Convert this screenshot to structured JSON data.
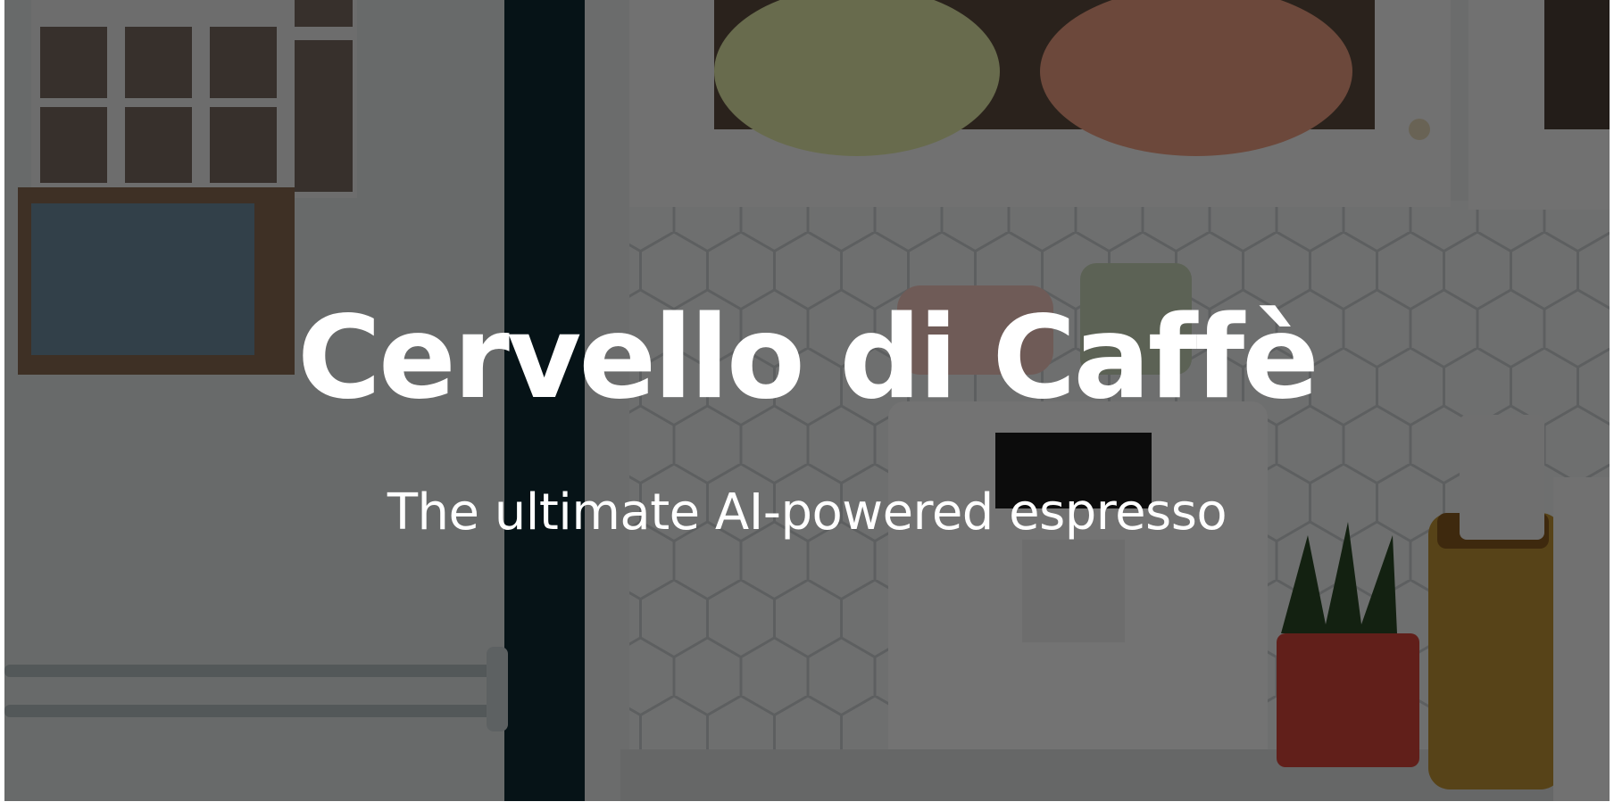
{
  "hero": {
    "title": "Cervello di Caffè",
    "subtitle": "The ultimate AI-powered espresso",
    "background": {
      "image": "kitchen-counter-with-espresso-machine-photo",
      "overlay_color": "#000000",
      "overlay_opacity": 0.55
    },
    "text_color": "#ffffff"
  }
}
